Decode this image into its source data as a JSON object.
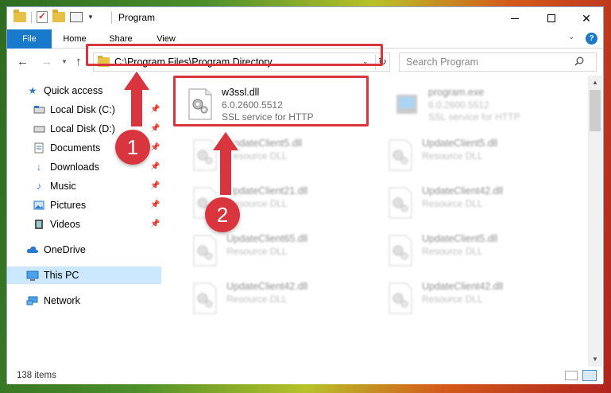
{
  "window": {
    "title": "Program",
    "controls": {
      "minimize": "minimize",
      "maximize": "maximize",
      "close": "✕"
    }
  },
  "ribbon": {
    "tabs": [
      {
        "label": "File",
        "active": true
      },
      {
        "label": "Home"
      },
      {
        "label": "Share"
      },
      {
        "label": "View"
      }
    ],
    "help": "?"
  },
  "nav": {
    "address": "C:\\Program Files\\Program Directory",
    "search_placeholder": "Search Program",
    "refresh_glyph": "↻"
  },
  "sidebar": {
    "items": [
      {
        "label": "Quick access",
        "icon": "star-icon"
      },
      {
        "label": "Local Disk (C:)",
        "icon": "drive-icon",
        "pinned": true
      },
      {
        "label": "Local Disk (D:)",
        "icon": "drive-icon",
        "pinned": true
      },
      {
        "label": "Documents",
        "icon": "documents-icon",
        "pinned": true
      },
      {
        "label": "Downloads",
        "icon": "download-icon",
        "pinned": true
      },
      {
        "label": "Music",
        "icon": "music-icon",
        "pinned": true
      },
      {
        "label": "Pictures",
        "icon": "pictures-icon",
        "pinned": true
      },
      {
        "label": "Videos",
        "icon": "videos-icon",
        "pinned": true
      },
      {
        "label": "OneDrive",
        "icon": "cloud-icon"
      },
      {
        "label": "This PC",
        "icon": "computer-icon",
        "selected": true
      },
      {
        "label": "Network",
        "icon": "network-icon"
      }
    ]
  },
  "files": [
    {
      "name": "w3ssl.dll",
      "version": "6.0.2600.5512",
      "description": "SSL service for HTTP",
      "highlighted": true
    },
    {
      "name": "program.exe",
      "version": "6.0.2600.5512",
      "description": "SSL service for HTTP"
    },
    {
      "name": "UpdateClient5.dll",
      "description": "Resource DLL"
    },
    {
      "name": "UpdateClient5.dll",
      "description": "Resource DLL"
    },
    {
      "name": "UpdateClient21.dll",
      "description": "Resource DLL"
    },
    {
      "name": "UpdateClient42.dll",
      "description": "Resource DLL"
    },
    {
      "name": "UpdateClient65.dll",
      "description": "Resource DLL"
    },
    {
      "name": "UpdateClient5.dll",
      "description": "Resource DLL"
    },
    {
      "name": "UpdateClient42.dll",
      "description": "Resource DLL"
    },
    {
      "name": "UpdateClient42.dll",
      "description": "Resource DLL"
    }
  ],
  "status": {
    "item_count": "138 items"
  },
  "annotations": [
    {
      "number": "1"
    },
    {
      "number": "2"
    }
  ],
  "colors": {
    "accent": "#1979ca",
    "highlight": "#d9353e",
    "selection": "#cce8ff"
  }
}
